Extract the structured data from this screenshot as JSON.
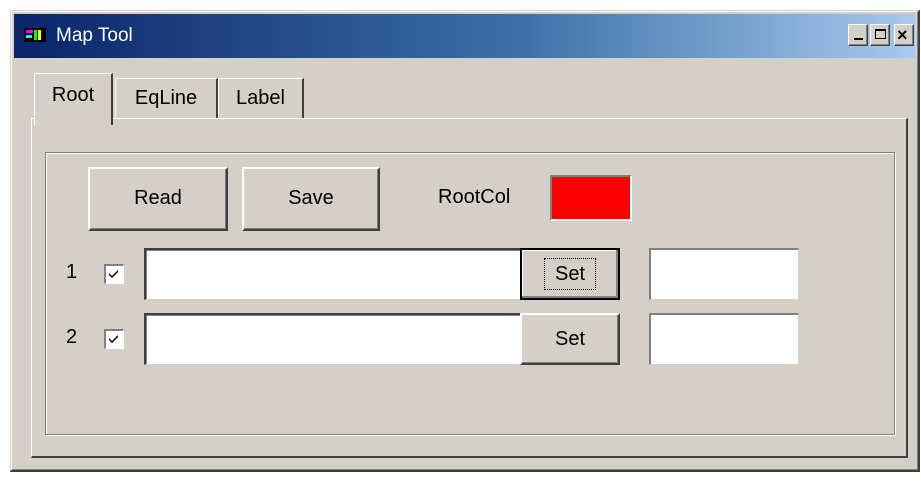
{
  "window": {
    "title": "Map Tool"
  },
  "tabs": [
    {
      "label": "Root",
      "selected": true
    },
    {
      "label": "EqLine",
      "selected": false
    },
    {
      "label": "Label",
      "selected": false
    }
  ],
  "root_tab": {
    "read_label": "Read",
    "save_label": "Save",
    "rootcol_label": "RootCol",
    "rootcol_color": "#ff0000",
    "rows": [
      {
        "number": "1",
        "checked": true,
        "path_value": "",
        "set_label": "Set",
        "extra_value": ""
      },
      {
        "number": "2",
        "checked": true,
        "path_value": "",
        "set_label": "Set",
        "extra_value": ""
      }
    ]
  }
}
